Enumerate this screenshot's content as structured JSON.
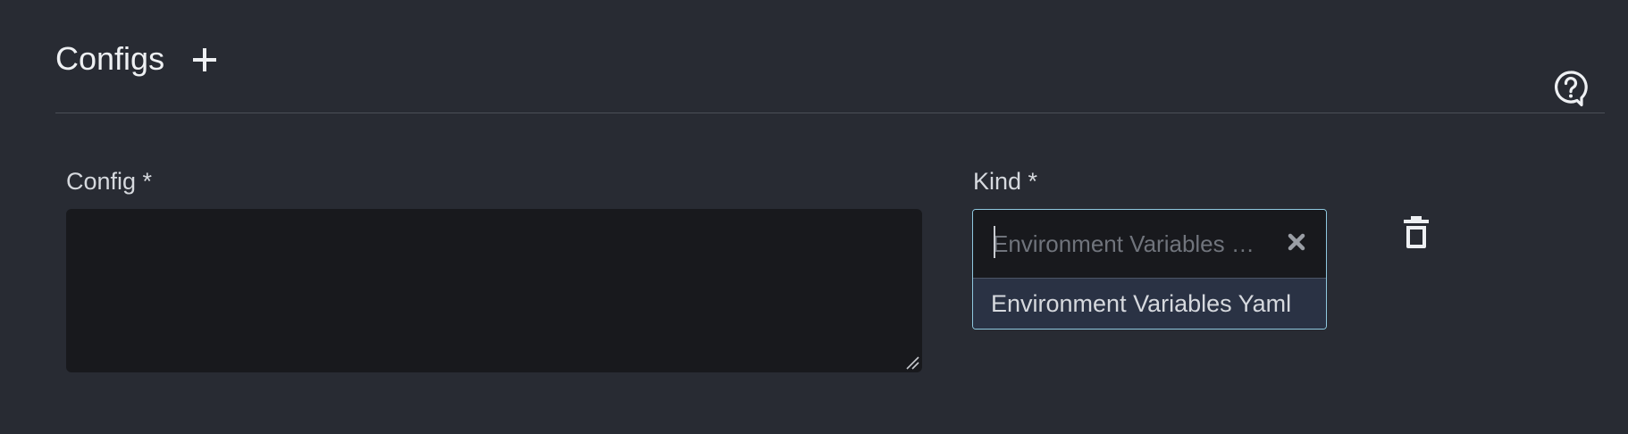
{
  "section": {
    "title": "Configs"
  },
  "config_field": {
    "label": "Config *",
    "value": ""
  },
  "kind_field": {
    "label": "Kind *",
    "placeholder": "Environment Variables …",
    "options": [
      {
        "label": "Environment Variables Yaml"
      }
    ]
  },
  "icons": {
    "add": "plus-icon",
    "help": "question-circle-icon",
    "clear": "close-icon",
    "delete": "trash-icon"
  },
  "colors": {
    "background": "#282b33",
    "field_background": "#18191d",
    "focus_border": "#8fc8df",
    "option_highlight": "#2a3244"
  }
}
